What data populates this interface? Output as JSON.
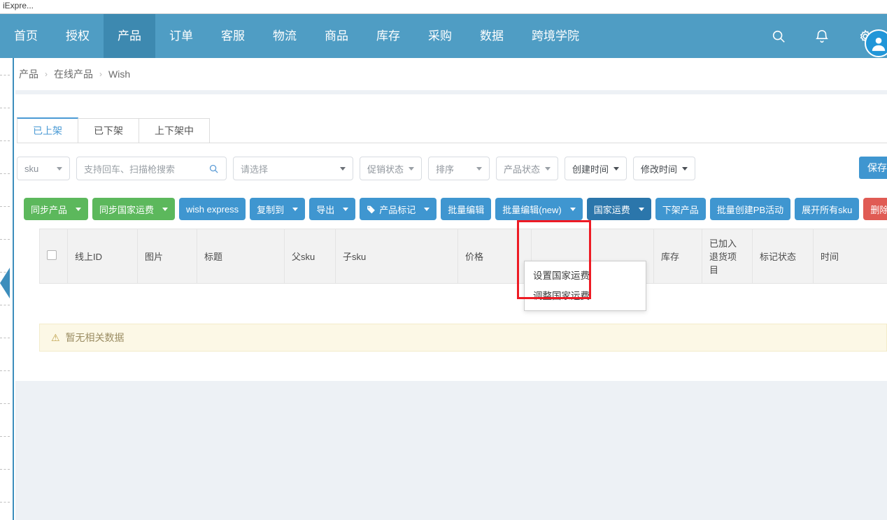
{
  "browser": {
    "tab_title": "iExpre..."
  },
  "topnav": {
    "items": [
      {
        "label": "首页",
        "active": false
      },
      {
        "label": "授权",
        "active": false
      },
      {
        "label": "产品",
        "active": true
      },
      {
        "label": "订单",
        "active": false
      },
      {
        "label": "客服",
        "active": false
      },
      {
        "label": "物流",
        "active": false
      },
      {
        "label": "商品",
        "active": false
      },
      {
        "label": "库存",
        "active": false
      },
      {
        "label": "采购",
        "active": false
      },
      {
        "label": "数据",
        "active": false
      },
      {
        "label": "跨境学院",
        "active": false
      }
    ],
    "icons": [
      "search-icon",
      "bell-icon",
      "gear-icon"
    ],
    "bg_color": "#4f9dc4",
    "active_bg_color": "#3d89b0"
  },
  "breadcrumb": {
    "items": [
      "产品",
      "在线产品",
      "Wish"
    ],
    "separator": "›"
  },
  "tabs": [
    {
      "label": "已上架",
      "active": true
    },
    {
      "label": "已下架",
      "active": false
    },
    {
      "label": "上下架中",
      "active": false
    }
  ],
  "filters": {
    "sku_select": "sku",
    "search_placeholder": "支持回车、扫描枪搜索",
    "search_value": "",
    "category_select": "请选择",
    "promo_status": "促销状态",
    "sort": "排序",
    "product_status": "产品状态",
    "create_time": "创建时间",
    "modify_time": "修改时间",
    "save_label": "保存"
  },
  "toolbar": {
    "buttons": [
      {
        "label": "同步产品",
        "style": "green",
        "caret": true,
        "icon": null
      },
      {
        "label": "同步国家运费",
        "style": "green",
        "caret": true,
        "icon": null
      },
      {
        "label": "wish express",
        "style": "blue",
        "caret": false,
        "icon": null
      },
      {
        "label": "复制到",
        "style": "blue",
        "caret": true,
        "icon": null
      },
      {
        "label": "导出",
        "style": "blue",
        "caret": true,
        "icon": null
      },
      {
        "label": "产品标记",
        "style": "blue",
        "caret": true,
        "icon": "tag-icon"
      },
      {
        "label": "批量编辑",
        "style": "blue",
        "caret": false,
        "icon": null
      },
      {
        "label": "批量编辑(new)",
        "style": "blue",
        "caret": true,
        "icon": null
      },
      {
        "label": "国家运费",
        "style": "blue-active",
        "caret": true,
        "icon": null
      },
      {
        "label": "下架产品",
        "style": "blue",
        "caret": false,
        "icon": null
      },
      {
        "label": "批量创建PB活动",
        "style": "blue",
        "caret": false,
        "icon": null
      },
      {
        "label": "展开所有sku",
        "style": "blue",
        "caret": false,
        "icon": null
      },
      {
        "label": "删除",
        "style": "red",
        "caret": false,
        "icon": "warning-badge"
      }
    ],
    "colors": {
      "green": "#5cb85c",
      "blue": "#3f96d0",
      "blue_active": "#2b76ab",
      "red": "#e05b54"
    }
  },
  "dropdown": {
    "open_for": "国家运费",
    "items": [
      "设置国家运费",
      "调整国家运费"
    ]
  },
  "highlight": {
    "color": "#ee1b24",
    "target": "国家运费"
  },
  "table": {
    "headers": [
      "",
      "线上ID",
      "图片",
      "标题",
      "父sku",
      "子sku",
      "价格",
      "",
      "库存",
      "已加入退货项目",
      "标记状态",
      "时间"
    ],
    "rows": [],
    "empty_message": "暂无相关数据"
  }
}
